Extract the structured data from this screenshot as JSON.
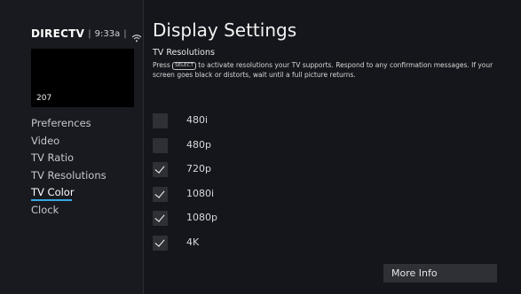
{
  "header": {
    "logo": "DIRECTV",
    "separator": "|",
    "time": "9:33a",
    "wifi_icon": "wifi-icon"
  },
  "preview": {
    "channel": "207"
  },
  "sidebar": {
    "items": [
      {
        "label": "Preferences",
        "active": false
      },
      {
        "label": "Video",
        "active": false
      },
      {
        "label": "TV Ratio",
        "active": false
      },
      {
        "label": "TV Resolutions",
        "active": false
      },
      {
        "label": "TV Color",
        "active": true
      },
      {
        "label": "Clock",
        "active": false
      }
    ],
    "accent": "#39a8e0"
  },
  "main": {
    "title": "Display Settings",
    "subtitle": "TV Resolutions",
    "desc_before_key": "Press",
    "desc_key": "SELECT",
    "desc_after_key": "to activate resolutions your TV supports. Respond to any confirmation messages. If your screen goes black or distorts, wait until a full picture returns."
  },
  "resolutions": [
    {
      "label": "480i",
      "checked": false
    },
    {
      "label": "480p",
      "checked": false
    },
    {
      "label": "720p",
      "checked": true
    },
    {
      "label": "1080i",
      "checked": true
    },
    {
      "label": "1080p",
      "checked": true
    },
    {
      "label": "4K",
      "checked": true
    }
  ],
  "more_info": {
    "label": "More Info"
  }
}
